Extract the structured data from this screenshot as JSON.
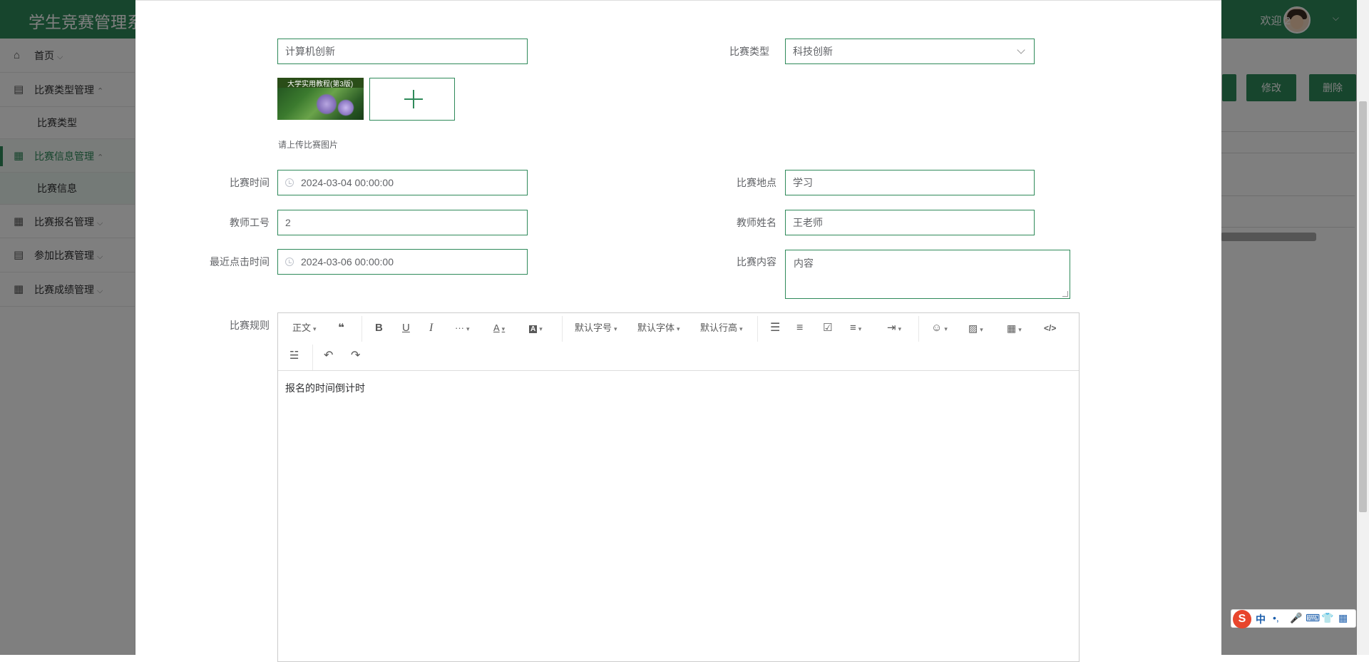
{
  "app": {
    "title": "学生竞赛管理系统",
    "welcome": "欢迎 2"
  },
  "sidebar": {
    "items": [
      {
        "label": "首页",
        "icon": "home-icon"
      },
      {
        "label": "比赛类型管理",
        "icon": "server-icon"
      },
      {
        "label": "比赛类型",
        "sub": true
      },
      {
        "label": "比赛信息管理",
        "icon": "grid-icon",
        "active": true
      },
      {
        "label": "比赛信息",
        "sub": true,
        "active": true
      },
      {
        "label": "比赛报名管理",
        "icon": "grid-icon"
      },
      {
        "label": "参加比赛管理",
        "icon": "server-icon"
      },
      {
        "label": "比赛成绩管理",
        "icon": "grid-icon"
      }
    ]
  },
  "background": {
    "edit_button": "修改",
    "delete_button": "删除"
  },
  "form": {
    "name": {
      "label": "比赛名称",
      "value": "计算机创新"
    },
    "type": {
      "label": "比赛类型",
      "value": "科技创新"
    },
    "image": {
      "label": "比赛图片",
      "tip": "请上传比赛图片",
      "thumb_title": "大学实用教程(第3版)"
    },
    "time": {
      "label": "比赛时间",
      "value": "2024-03-04 00:00:00"
    },
    "place": {
      "label": "比赛地点",
      "value": "学习"
    },
    "teacher_id": {
      "label": "教师工号",
      "value": "2"
    },
    "teacher_name": {
      "label": "教师姓名",
      "value": "王老师"
    },
    "last_click": {
      "label": "最近点击时间",
      "value": "2024-03-06 00:00:00"
    },
    "content": {
      "label": "比赛内容",
      "value": "内容"
    },
    "rules": {
      "label": "比赛规则",
      "value": "报名的时间倒计时"
    }
  },
  "editor_toolbar": {
    "paragraph": "正文",
    "font_size": "默认字号",
    "font_family": "默认字体",
    "line_height": "默认行高"
  },
  "ime": {
    "logo": "S",
    "lang": "中"
  },
  "colors": {
    "accent": "#2f8a5a",
    "overlay": "rgba(0,0,0,0.5)"
  }
}
